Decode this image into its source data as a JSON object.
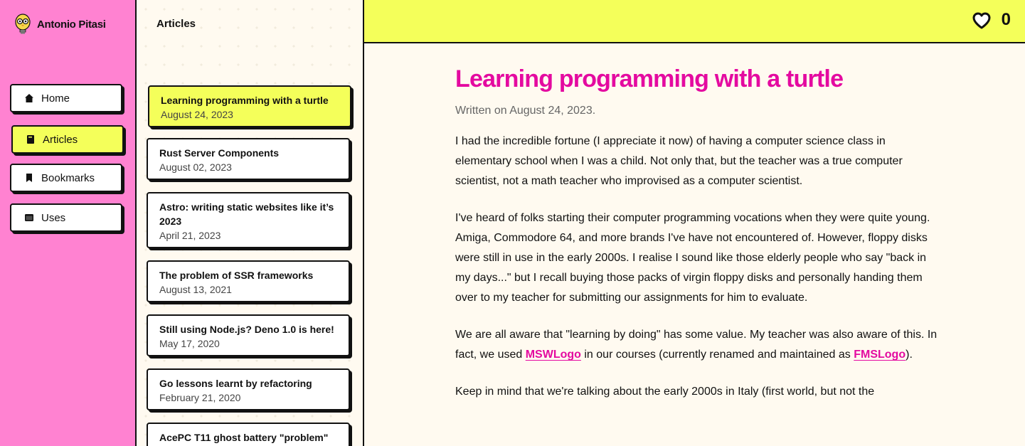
{
  "brand": {
    "name": "Antonio Pitasi",
    "logo_icon": "owl-bulb-icon"
  },
  "nav": {
    "items": [
      {
        "label": "Home",
        "icon": "home-icon",
        "active": false
      },
      {
        "label": "Articles",
        "icon": "book-icon",
        "active": true
      },
      {
        "label": "Bookmarks",
        "icon": "bookmark-icon",
        "active": false
      },
      {
        "label": "Uses",
        "icon": "laptop-icon",
        "active": false
      }
    ]
  },
  "list": {
    "title": "Articles",
    "items": [
      {
        "title": "Learning programming with a turtle",
        "date": "August 24, 2023",
        "active": true
      },
      {
        "title": "Rust Server Components",
        "date": "August 02, 2023"
      },
      {
        "title": "Astro: writing static websites like it’s 2023",
        "date": "April 21, 2023"
      },
      {
        "title": "The problem of SSR frameworks",
        "date": "August 13, 2021"
      },
      {
        "title": "Still using Node.js? Deno 1.0 is here!",
        "date": "May 17, 2020"
      },
      {
        "title": "Go lessons learnt by refactoring",
        "date": "February 21, 2020"
      },
      {
        "title": "AcePC T11 ghost battery \"problem\"",
        "date": ""
      }
    ]
  },
  "topbar": {
    "likes": "0",
    "like_icon": "heart-icon"
  },
  "article": {
    "title": "Learning programming with a turtle",
    "meta": "Written on August 24, 2023.",
    "p1": "I had the incredible fortune (I appreciate it now) of having a computer science class in elementary school when I was a child. Not only that, but the teacher was a true computer scientist, not a math teacher who improvised as a computer scientist.",
    "p2": "I've heard of folks starting their computer programming vocations when they were quite young. Amiga, Commodore 64, and more brands I've have not encountered of. However, floppy disks were still in use in the early 2000s. I realise I sound like those elderly people who say \"back in my days...\" but I recall buying those packs of virgin floppy disks and personally handing them over to my teacher for submitting our assignments for him to evaluate.",
    "p3_a": "We are all aware that \"learning by doing\" has some value. My teacher was also aware of this. In fact, we used ",
    "p3_link1": "MSWLogo",
    "p3_b": " in our courses (currently renamed and maintained as ",
    "p3_link2": "FMSLogo",
    "p3_c": ").",
    "p4": "Keep in mind that we're talking about the early 2000s in Italy (first world, but not the"
  },
  "colors": {
    "pink": "#ff82d1",
    "yellow": "#f4ff5a",
    "magenta": "#e40aa0",
    "cream": "#fffaf0"
  }
}
